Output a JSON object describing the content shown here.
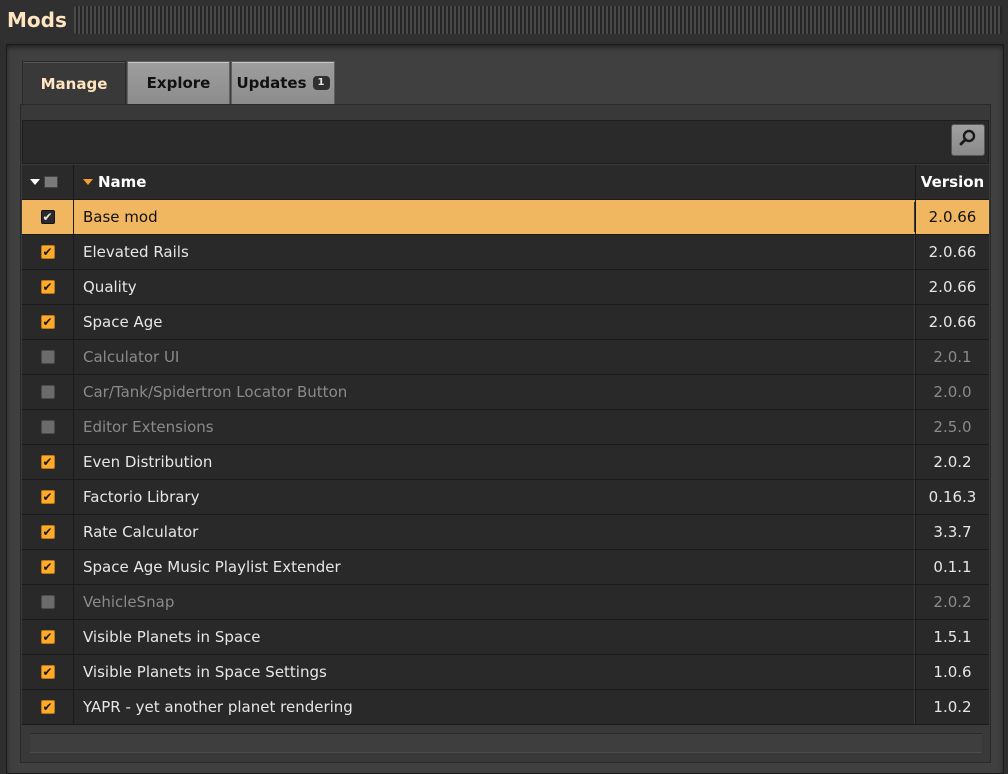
{
  "window": {
    "title": "Mods"
  },
  "tabs": [
    {
      "label": "Manage",
      "active": true
    },
    {
      "label": "Explore",
      "active": false
    },
    {
      "label": "Updates",
      "active": false,
      "badge": "1"
    }
  ],
  "table": {
    "columns": {
      "name": "Name",
      "version": "Version"
    },
    "rows": [
      {
        "name": "Base mod",
        "version": "2.0.66",
        "enabled": true,
        "selected": true
      },
      {
        "name": "Elevated Rails",
        "version": "2.0.66",
        "enabled": true
      },
      {
        "name": "Quality",
        "version": "2.0.66",
        "enabled": true
      },
      {
        "name": "Space Age",
        "version": "2.0.66",
        "enabled": true
      },
      {
        "name": "Calculator UI",
        "version": "2.0.1",
        "enabled": false
      },
      {
        "name": "Car/Tank/Spidertron Locator Button",
        "version": "2.0.0",
        "enabled": false
      },
      {
        "name": "Editor Extensions",
        "version": "2.5.0",
        "enabled": false
      },
      {
        "name": "Even Distribution",
        "version": "2.0.2",
        "enabled": true
      },
      {
        "name": "Factorio Library",
        "version": "0.16.3",
        "enabled": true
      },
      {
        "name": "Rate Calculator",
        "version": "3.3.7",
        "enabled": true
      },
      {
        "name": "Space Age Music Playlist Extender",
        "version": "0.1.1",
        "enabled": true
      },
      {
        "name": "VehicleSnap",
        "version": "2.0.2",
        "enabled": false
      },
      {
        "name": "Visible Planets in Space",
        "version": "1.5.1",
        "enabled": true
      },
      {
        "name": "Visible Planets in Space Settings",
        "version": "1.0.6",
        "enabled": true
      },
      {
        "name": "YAPR - yet another planet rendering",
        "version": "1.0.2",
        "enabled": true
      }
    ]
  },
  "colors": {
    "accent": "#f0b760",
    "checkbox_on": "#ffaa2b",
    "title": "#ffe6c0"
  },
  "icons": {
    "search": "search-icon",
    "sort": "sort-arrow-icon",
    "check": "check-icon"
  }
}
